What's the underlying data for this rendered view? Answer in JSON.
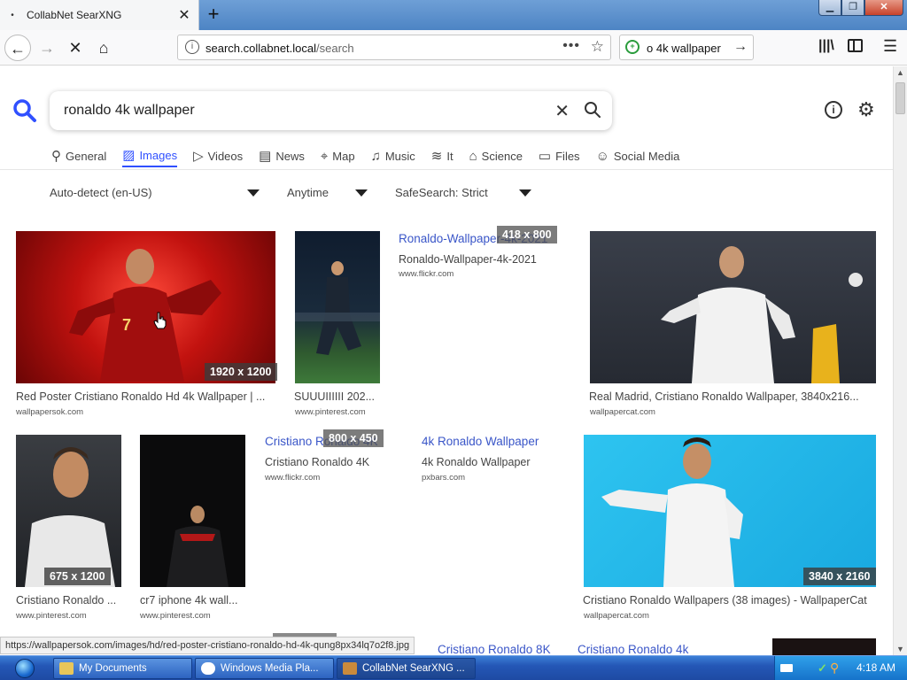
{
  "browser": {
    "tab_title": "CollabNet SearXNG",
    "tab_close": "✕",
    "new_tab": "+",
    "url_host": "search.collabnet.local",
    "url_path": "/search",
    "search_box_text": "o 4k wallpaper"
  },
  "header": {
    "query": "ronaldo 4k wallpaper"
  },
  "categories": [
    {
      "label": "General",
      "icon": "search-icon"
    },
    {
      "label": "Images",
      "icon": "image-icon"
    },
    {
      "label": "Videos",
      "icon": "play-icon"
    },
    {
      "label": "News",
      "icon": "newspaper-icon"
    },
    {
      "label": "Map",
      "icon": "map-pin-icon"
    },
    {
      "label": "Music",
      "icon": "music-note-icon"
    },
    {
      "label": "It",
      "icon": "stack-icon"
    },
    {
      "label": "Science",
      "icon": "graduation-cap-icon"
    },
    {
      "label": "Files",
      "icon": "drive-icon"
    },
    {
      "label": "Social Media",
      "icon": "users-icon"
    }
  ],
  "filters": {
    "language": "Auto-detect (en-US)",
    "time": "Anytime",
    "safesearch": "SafeSearch: Strict"
  },
  "results": [
    {
      "title": "Red Poster Cristiano Ronaldo Hd 4k Wallpaper | ...",
      "source": "wallpapersok.com",
      "dim": "1920 x 1200"
    },
    {
      "title": "SUUUIIIIII 202...",
      "source": "www.pinterest.com"
    },
    {
      "link": "Ronaldo-Wallpaper-4k-2021",
      "title": "Ronaldo-Wallpaper-4k-2021",
      "source": "www.flickr.com",
      "dim": "418 x 800"
    },
    {
      "title": "Real Madrid, Cristiano Ronaldo Wallpaper, 3840x216...",
      "source": "wallpapercat.com"
    },
    {
      "title": "Cristiano Ronaldo ...",
      "source": "www.pinterest.com",
      "dim": "675 x 1200"
    },
    {
      "title": "cr7 iphone 4k wall...",
      "source": "www.pinterest.com"
    },
    {
      "link": "Cristiano Ronaldo 4K",
      "title": "Cristiano Ronaldo 4K",
      "source": "www.flickr.com",
      "dim": "800 x 450"
    },
    {
      "link": "4k Ronaldo Wallpaper",
      "title": "4k Ronaldo Wallpaper",
      "source": "pxbars.com"
    },
    {
      "title": "Cristiano Ronaldo Wallpapers (38 images) - WallpaperCat",
      "source": "wallpapercat.com",
      "dim": "3840 x 2160"
    }
  ],
  "partial_links": [
    "Cristiano Ronaldo 8K",
    "Cristiano Ronaldo 4k"
  ],
  "status_url": "https://wallpapersok.com/images/hd/red-poster-cristiano-ronaldo-hd-4k-qung8px34lq7o2f8.jpg",
  "taskbar": {
    "items": [
      "My Documents",
      "Windows Media Pla...",
      "CollabNet SearXNG ..."
    ],
    "clock": "4:18 AM"
  },
  "colors": {
    "accent": "#3050ff",
    "link": "#3a56c8"
  }
}
